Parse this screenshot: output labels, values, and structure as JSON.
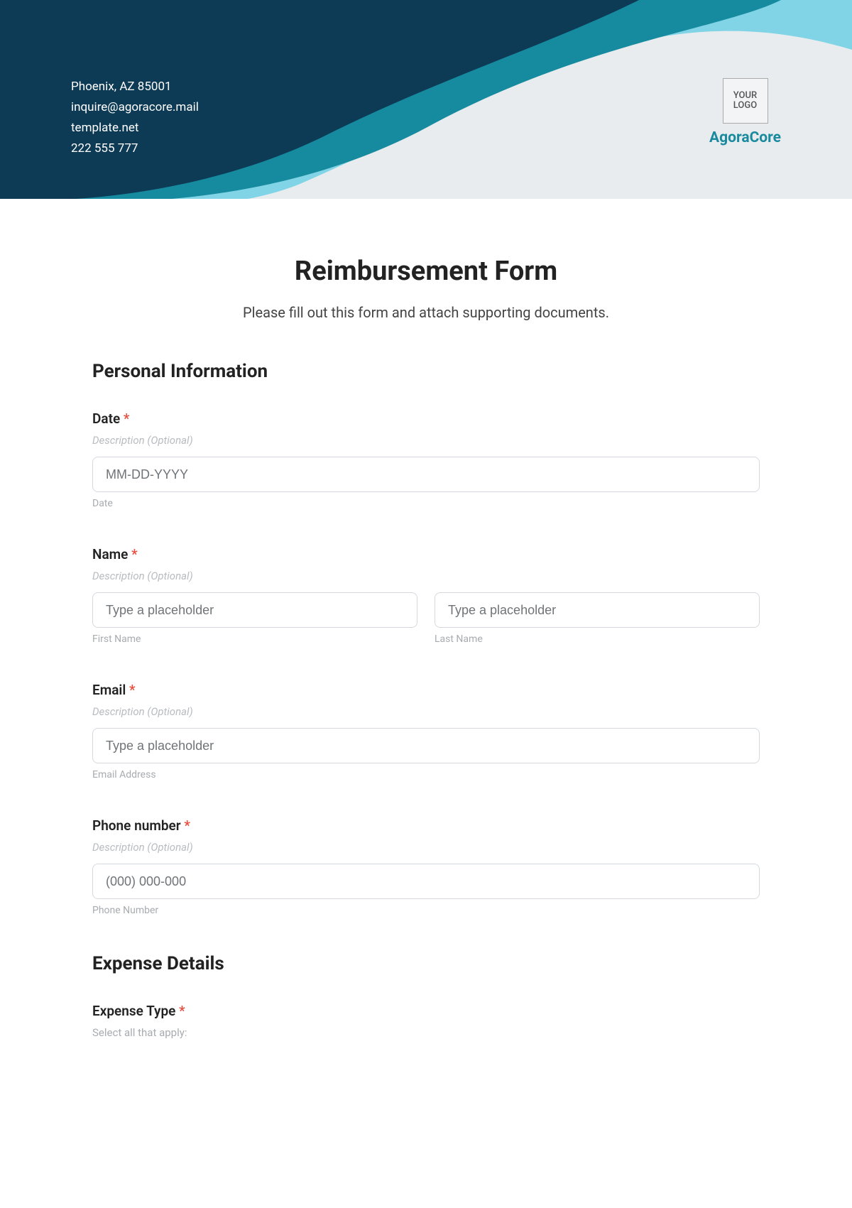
{
  "header": {
    "address": "Phoenix, AZ 85001",
    "email": "inquire@agoracore.mail",
    "website": "template.net",
    "phone": "222 555 777",
    "logo_placeholder": "YOUR LOGO",
    "brand": "AgoraCore"
  },
  "form": {
    "title": "Reimbursement Form",
    "subtitle": "Please fill out this form and attach supporting documents."
  },
  "sections": {
    "personal": {
      "heading": "Personal Information",
      "date": {
        "label": "Date",
        "desc": "Description (Optional)",
        "placeholder": "MM-DD-YYYY",
        "hint": "Date"
      },
      "name": {
        "label": "Name",
        "desc": "Description (Optional)",
        "first_placeholder": "Type a placeholder",
        "first_hint": "First Name",
        "last_placeholder": "Type a placeholder",
        "last_hint": "Last Name"
      },
      "email": {
        "label": "Email",
        "desc": "Description (Optional)",
        "placeholder": "Type a placeholder",
        "hint": "Email Address"
      },
      "phone": {
        "label": "Phone number",
        "desc": "Description (Optional)",
        "placeholder": "(000) 000-000",
        "hint": "Phone Number"
      }
    },
    "expense": {
      "heading": "Expense Details",
      "type": {
        "label": "Expense Type",
        "hint": "Select all that apply:"
      }
    }
  },
  "asterisk": "*"
}
